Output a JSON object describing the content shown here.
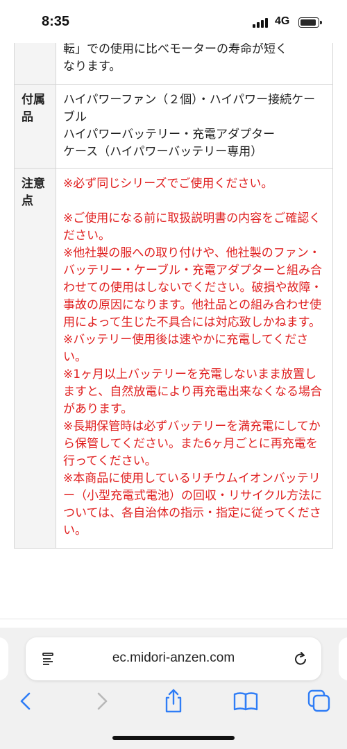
{
  "status_bar": {
    "time": "8:35",
    "network": "4G"
  },
  "spec_table": {
    "motor_row": {
      "lines": [
        "転」での使用に比べモーターの寿命が短く",
        "なります。"
      ]
    },
    "accessories_row": {
      "label": "付属品",
      "lines": [
        "ハイパワーファン（２個）・ハイパワー接続ケーブル",
        "ハイパワーバッテリー・充電アダプター",
        "ケース（ハイパワーバッテリー専用）"
      ]
    },
    "notes_row": {
      "label": "注意点",
      "first": "※必ず同じシリーズでご使用ください。",
      "items": [
        "※ご使用になる前に取扱説明書の内容をご確認ください。",
        "※他社製の服への取り付けや、他社製のファン・バッテリー・ケーブル・充電アダプターと組み合わせての使用はしないでください。破損や故障・事故の原因になります。他社品との組み合わせ使用によって生じた不具合には対応致しかねます。",
        "※バッテリー使用後は速やかに充電してください。",
        "※1ヶ月以上バッテリーを充電しないまま放置しますと、自然放電により再充電出来なくなる場合があります。",
        "※長期保管時は必ずバッテリーを満充電にしてから保管してください。また6ヶ月ごとに再充電を行ってください。",
        "※本商品に使用しているリチウムイオンバッテリー（小型充電式電池）の回収・リサイクル方法については、各自治体の指示・指定に従ってください。"
      ]
    }
  },
  "browser": {
    "url": "ec.midori-anzen.com",
    "icons": {
      "page_settings": "page-menu-icon",
      "reload": "reload-icon",
      "back": "chevron-left-icon",
      "forward": "chevron-right-icon",
      "share": "share-icon",
      "bookmarks": "book-icon",
      "tabs": "tabs-icon"
    },
    "colors": {
      "accent": "#2f7df6",
      "disabled": "#b8b8b8",
      "note_red": "#e02020"
    }
  }
}
